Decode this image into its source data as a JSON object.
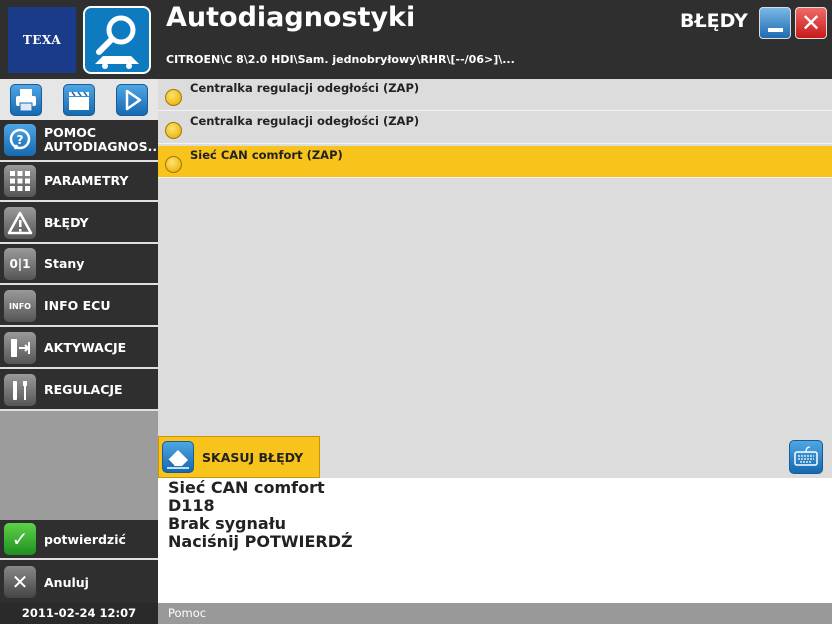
{
  "header": {
    "logo_text": "TEXA",
    "title": "Autodiagnostyki",
    "section": "BŁĘDY",
    "path": "CITROEN\\C 8\\2.0 HDI\\Sam. jednobryłowy\\RHR\\[--/06>]\\..."
  },
  "menu": {
    "help": "POMOC AUTODIAGNOS...",
    "params": "PARAMETRY",
    "faults": "BŁĘDY",
    "states": "Stany",
    "info": "INFO ECU",
    "activations": "AKTYWACJE",
    "adjustments": "REGULACJE",
    "confirm": "potwierdzić",
    "cancel": "Anuluj"
  },
  "icons": {
    "states_glyph": "0|1",
    "info_glyph": "INFO"
  },
  "list": [
    "Centralka regulacji odegłości (ZAP)",
    "Centralka regulacji odegłości (ZAP)",
    "Sieć CAN comfort (ZAP)"
  ],
  "selected_index": 2,
  "actions": {
    "erase": "SKASUJ BŁĘDY"
  },
  "details": [
    "Sieć CAN comfort",
    "D118",
    "Brak sygnału",
    "Naciśnij POTWIERDŹ"
  ],
  "footer": {
    "datetime": "2011-02-24  12:07",
    "status": "Pomoc"
  },
  "colors": {
    "accent_yellow": "#f8c31a",
    "panel_dark": "#2f2f2f",
    "icon_blue": "#1569b0"
  }
}
